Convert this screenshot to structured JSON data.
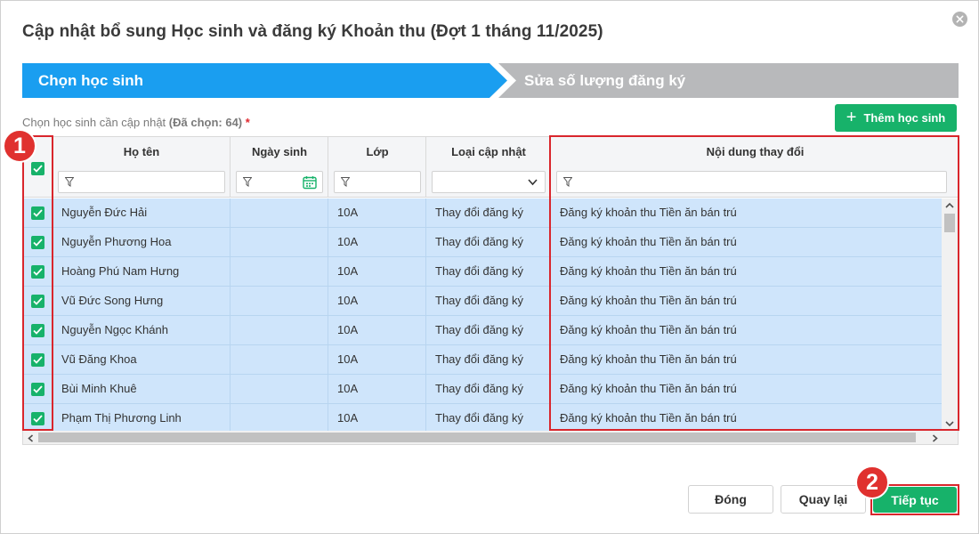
{
  "dialog": {
    "title": "Cập nhật bổ sung Học sinh và đăng ký Khoản thu (Đợt 1 tháng 11/2025)",
    "close_icon": "close-icon"
  },
  "steps": [
    {
      "label": "Chọn học sinh",
      "state": "active",
      "color": "#1a9ef0"
    },
    {
      "label": "Sửa số lượng đăng ký",
      "state": "inactive",
      "color": "#b8b9bb"
    }
  ],
  "hint": {
    "text": "Chọn học sinh cần cập nhật",
    "selected": "(Đã chọn: 64)",
    "required_mark": "*"
  },
  "add_button": {
    "label": "Thêm học sinh",
    "icon": "plus-icon"
  },
  "table": {
    "columns": [
      {
        "key": "select",
        "label": ""
      },
      {
        "key": "name",
        "label": "Họ tên"
      },
      {
        "key": "dob",
        "label": "Ngày sinh"
      },
      {
        "key": "class",
        "label": "Lớp"
      },
      {
        "key": "type",
        "label": "Loại cập nhật"
      },
      {
        "key": "content",
        "label": "Nội dung thay đổi"
      }
    ],
    "rows": [
      {
        "checked": true,
        "name": "Nguyễn Đức Hải",
        "dob": "",
        "class": "10A",
        "type": "Thay đổi đăng ký",
        "content": "Đăng ký khoản thu Tiền ăn bán trú"
      },
      {
        "checked": true,
        "name": "Nguyễn Phương Hoa",
        "dob": "",
        "class": "10A",
        "type": "Thay đổi đăng ký",
        "content": "Đăng ký khoản thu Tiền ăn bán trú"
      },
      {
        "checked": true,
        "name": "Hoàng Phú Nam Hưng",
        "dob": "",
        "class": "10A",
        "type": "Thay đổi đăng ký",
        "content": "Đăng ký khoản thu Tiền ăn bán trú"
      },
      {
        "checked": true,
        "name": "Vũ Đức Song Hưng",
        "dob": "",
        "class": "10A",
        "type": "Thay đổi đăng ký",
        "content": "Đăng ký khoản thu Tiền ăn bán trú"
      },
      {
        "checked": true,
        "name": "Nguyễn Ngọc Khánh",
        "dob": "",
        "class": "10A",
        "type": "Thay đổi đăng ký",
        "content": "Đăng ký khoản thu Tiền ăn bán trú"
      },
      {
        "checked": true,
        "name": "Vũ Đăng Khoa",
        "dob": "",
        "class": "10A",
        "type": "Thay đổi đăng ký",
        "content": "Đăng ký khoản thu Tiền ăn bán trú"
      },
      {
        "checked": true,
        "name": "Bùi Minh Khuê",
        "dob": "",
        "class": "10A",
        "type": "Thay đổi đăng ký",
        "content": "Đăng ký khoản thu Tiền ăn bán trú"
      },
      {
        "checked": true,
        "name": "Phạm Thị Phương Linh",
        "dob": "",
        "class": "10A",
        "type": "Thay đổi đăng ký",
        "content": "Đăng ký khoản thu Tiền ăn bán trú"
      }
    ]
  },
  "annotations": [
    {
      "number": "1"
    },
    {
      "number": "2"
    }
  ],
  "footer": {
    "close_label": "Đóng",
    "back_label": "Quay lại",
    "next_label": "Tiếp tục"
  },
  "colors": {
    "accent_green": "#17b26a",
    "step_active": "#1a9ef0",
    "row_selected": "#cfe5fb",
    "highlight_red": "#d9262c"
  }
}
